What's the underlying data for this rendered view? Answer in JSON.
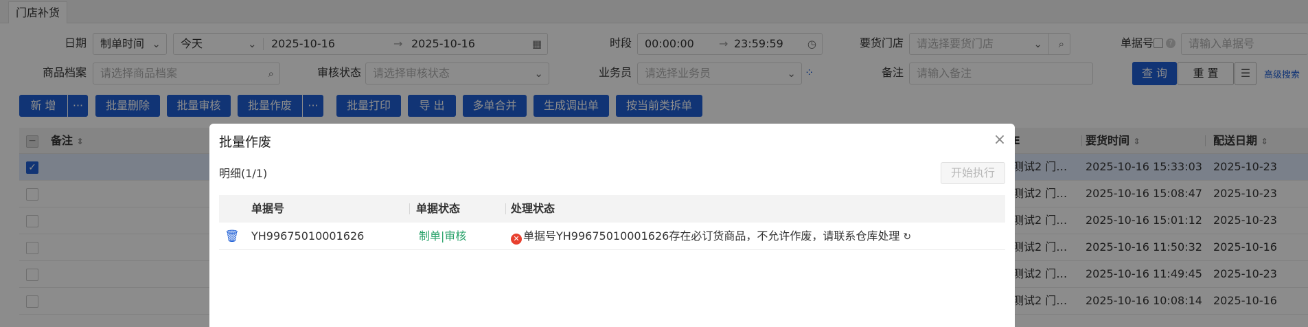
{
  "tabs": {
    "active": "门店补货"
  },
  "filters": {
    "date_label": "日期",
    "date_type": "制单时间",
    "date_preset": "今天",
    "date_from": "2025-10-16",
    "date_to": "2025-10-16",
    "period_label": "时段",
    "time_from": "00:00:00",
    "time_to": "23:59:59",
    "store_label": "要货门店",
    "store_placeholder": "请选择要货门店",
    "doc_no_label": "单据号",
    "doc_no_placeholder": "请输入单据号",
    "goods_label": "商品档案",
    "goods_placeholder": "请选择商品档案",
    "audit_label": "审核状态",
    "audit_placeholder": "请选择审核状态",
    "salesman_label": "业务员",
    "salesman_placeholder": "请选择业务员",
    "remark_label": "备注",
    "remark_placeholder": "请输入备注",
    "query_btn": "查 询",
    "reset_btn": "重 置",
    "advanced_link": "高级搜索"
  },
  "toolbar": {
    "add": "新 增",
    "more1": "···",
    "batch_delete": "批量删除",
    "batch_audit": "批量审核",
    "batch_void": "批量作废",
    "more2": "···",
    "batch_print": "批量打印",
    "export": "导 出",
    "merge": "多单合并",
    "gen_transfer": "生成调出单",
    "split": "按当前类拆单"
  },
  "table": {
    "col_remark": "备注",
    "col_store_trunc": "E",
    "col_request_time": "要货时间",
    "col_delivery_date": "配送日期",
    "rows": [
      {
        "store": "测试2 门…",
        "request_time": "2025-10-16 15:33:03",
        "delivery_date": "2025-10-23",
        "checked": true
      },
      {
        "store": "测试2 门…",
        "request_time": "2025-10-16 15:08:47",
        "delivery_date": "2025-10-23",
        "checked": false
      },
      {
        "store": "测试2 门…",
        "request_time": "2025-10-16 15:01:12",
        "delivery_date": "2025-10-23",
        "checked": false
      },
      {
        "store": "测试2 门…",
        "request_time": "2025-10-16 11:50:32",
        "delivery_date": "2025-10-16",
        "checked": false
      },
      {
        "store": "测试2 门…",
        "request_time": "2025-10-16 11:49:45",
        "delivery_date": "2025-10-23",
        "checked": false
      },
      {
        "store": "测试2 门…",
        "request_time": "2025-10-16 10:08:14",
        "delivery_date": "2025-10-16",
        "checked": false
      }
    ]
  },
  "modal": {
    "title": "批量作废",
    "detail": "明细(1/1)",
    "exec_btn": "开始执行",
    "col_doc_no": "单据号",
    "col_doc_status": "单据状态",
    "col_process_status": "处理状态",
    "row": {
      "doc_no": "YH99675010001626",
      "doc_status": "制单|审核",
      "process_status": "单据号YH99675010001626存在必订货商品，不允许作废，请联系仓库处理"
    }
  },
  "colors": {
    "primary": "#1f5fd6",
    "error": "#e8402f",
    "success": "#2aa36b"
  }
}
